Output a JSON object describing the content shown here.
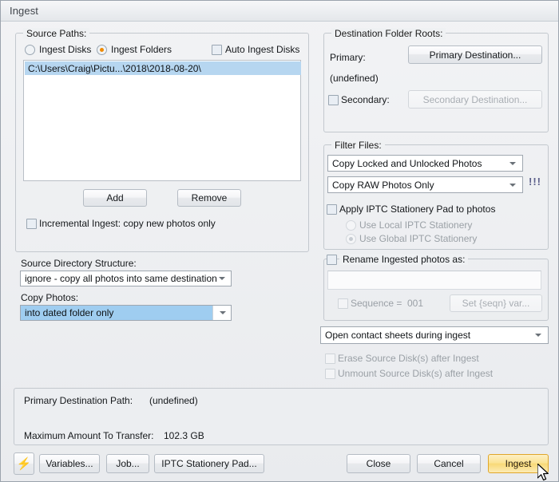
{
  "window": {
    "title": "Ingest"
  },
  "source_paths": {
    "legend": "Source Paths:",
    "radio_ingest_disks": "Ingest Disks",
    "radio_ingest_folders": "Ingest Folders",
    "checkbox_auto_ingest_disks": "Auto Ingest Disks",
    "selected_radio": "Ingest Folders",
    "list": [
      "C:\\Users\\Craig\\Pictu...\\2018\\2018-08-20\\"
    ],
    "add_button": "Add",
    "remove_button": "Remove",
    "incremental_ingest": "Incremental Ingest: copy new photos only"
  },
  "source_directory": {
    "label": "Source Directory Structure:",
    "value": "ignore - copy all photos into same destination",
    "copy_photos_label": "Copy Photos:",
    "copy_photos_value": "into dated folder only"
  },
  "destination": {
    "legend": "Destination Folder Roots:",
    "primary_label": "Primary:",
    "primary_button": "Primary Destination...",
    "primary_value": "(undefined)",
    "secondary_label": "Secondary:",
    "secondary_button": "Secondary Destination..."
  },
  "filter_files": {
    "label": "Filter Files:",
    "lock_filter_value": "Copy Locked and Unlocked Photos",
    "type_filter_value": "Copy RAW Photos Only",
    "warning_marker": "!!!",
    "apply_iptc_label": "Apply IPTC Stationery Pad to photos",
    "radio_local": "Use Local IPTC Stationery",
    "radio_global": "Use Global IPTC Stationery",
    "selected_iptc_radio": "Use Global IPTC Stationery"
  },
  "rename": {
    "legend": "Rename Ingested photos as:",
    "pattern_value": "",
    "sequence_label": "Sequence =",
    "sequence_value": "001",
    "set_seqn_button": "Set {seqn} var..."
  },
  "options": {
    "contact_sheets_value": "Open contact sheets during ingest",
    "erase_source": "Erase Source Disk(s) after Ingest",
    "unmount_source": "Unmount Source Disk(s) after Ingest"
  },
  "summary": {
    "primary_path_label": "Primary Destination Path:",
    "primary_path_value": "(undefined)",
    "max_transfer_label": "Maximum Amount To Transfer:",
    "max_transfer_value": "102.3 GB"
  },
  "footer": {
    "bolt_icon": "lightning-bolt-icon",
    "variables_button": "Variables...",
    "job_button": "Job...",
    "iptc_pad_button": "IPTC Stationery Pad...",
    "close_button": "Close",
    "cancel_button": "Cancel",
    "ingest_button": "Ingest"
  },
  "colors": {
    "accent_orange": "#f08a00",
    "ingest_button": "#f8d977",
    "selection_blue": "#b6d6f0",
    "warning": "#5b5f8a"
  }
}
